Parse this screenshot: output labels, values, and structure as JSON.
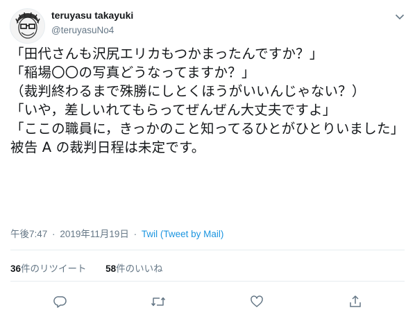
{
  "user": {
    "name": "teruyasu takayuki",
    "handle": "@teruyasuNo4"
  },
  "tweet": {
    "text": "「田代さんも沢尻エリカもつかまったんですか？」\n「稲場〇〇の写真どうなってますか？」\n（裁判終わるまで殊勝にしとくほうがいいんじゃない？）\n「いや，差しいれてもらってぜんぜん大丈夫ですよ」\n「ここの職員に，きっかのこと知ってるひとがひとりいました」\n被告 A の裁判日程は未定です。",
    "time": "午後7:47",
    "dot": "·",
    "date": "2019年11月19日",
    "source": "Twil (Tweet by Mail)"
  },
  "stats": {
    "retweets_count": "36",
    "retweets_label": "件のリツイート",
    "likes_count": "58",
    "likes_label": "件のいいね"
  },
  "icons": {
    "caret": "chevron-down-icon",
    "reply": "reply-icon",
    "retweet": "retweet-icon",
    "like": "heart-icon",
    "share": "share-icon"
  },
  "colors": {
    "text": "#14171a",
    "secondary": "#657786",
    "link": "#1b95e0",
    "divider": "#e6ecf0"
  }
}
